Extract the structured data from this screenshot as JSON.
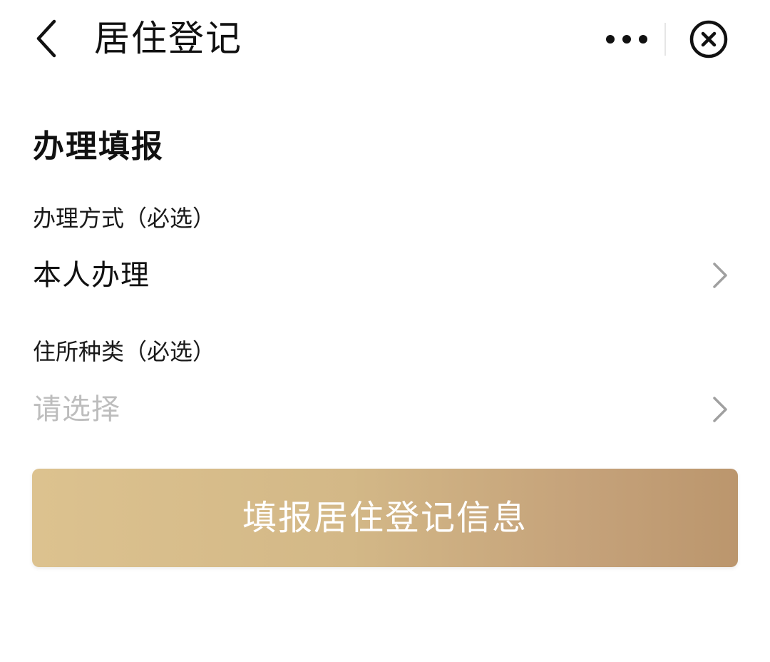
{
  "header": {
    "title": "居住登记",
    "back_icon": "chevron-left-icon",
    "more_icon": "more-dots-icon",
    "close_icon": "close-circle-icon"
  },
  "form": {
    "section_title": "办理填报",
    "fields": [
      {
        "label": "办理方式（必选）",
        "value": "本人办理",
        "is_placeholder": false,
        "chevron_icon": "chevron-right-icon"
      },
      {
        "label": "住所种类（必选）",
        "value": "请选择",
        "is_placeholder": true,
        "chevron_icon": "chevron-right-icon"
      }
    ],
    "submit_label": "填报居住登记信息"
  },
  "colors": {
    "text_primary": "#111111",
    "placeholder": "#bdbdbd",
    "chevron": "#a0a0a0",
    "button_gradient_start": "#dcc28f",
    "button_gradient_end": "#bb966d",
    "button_text": "#ffffff"
  }
}
